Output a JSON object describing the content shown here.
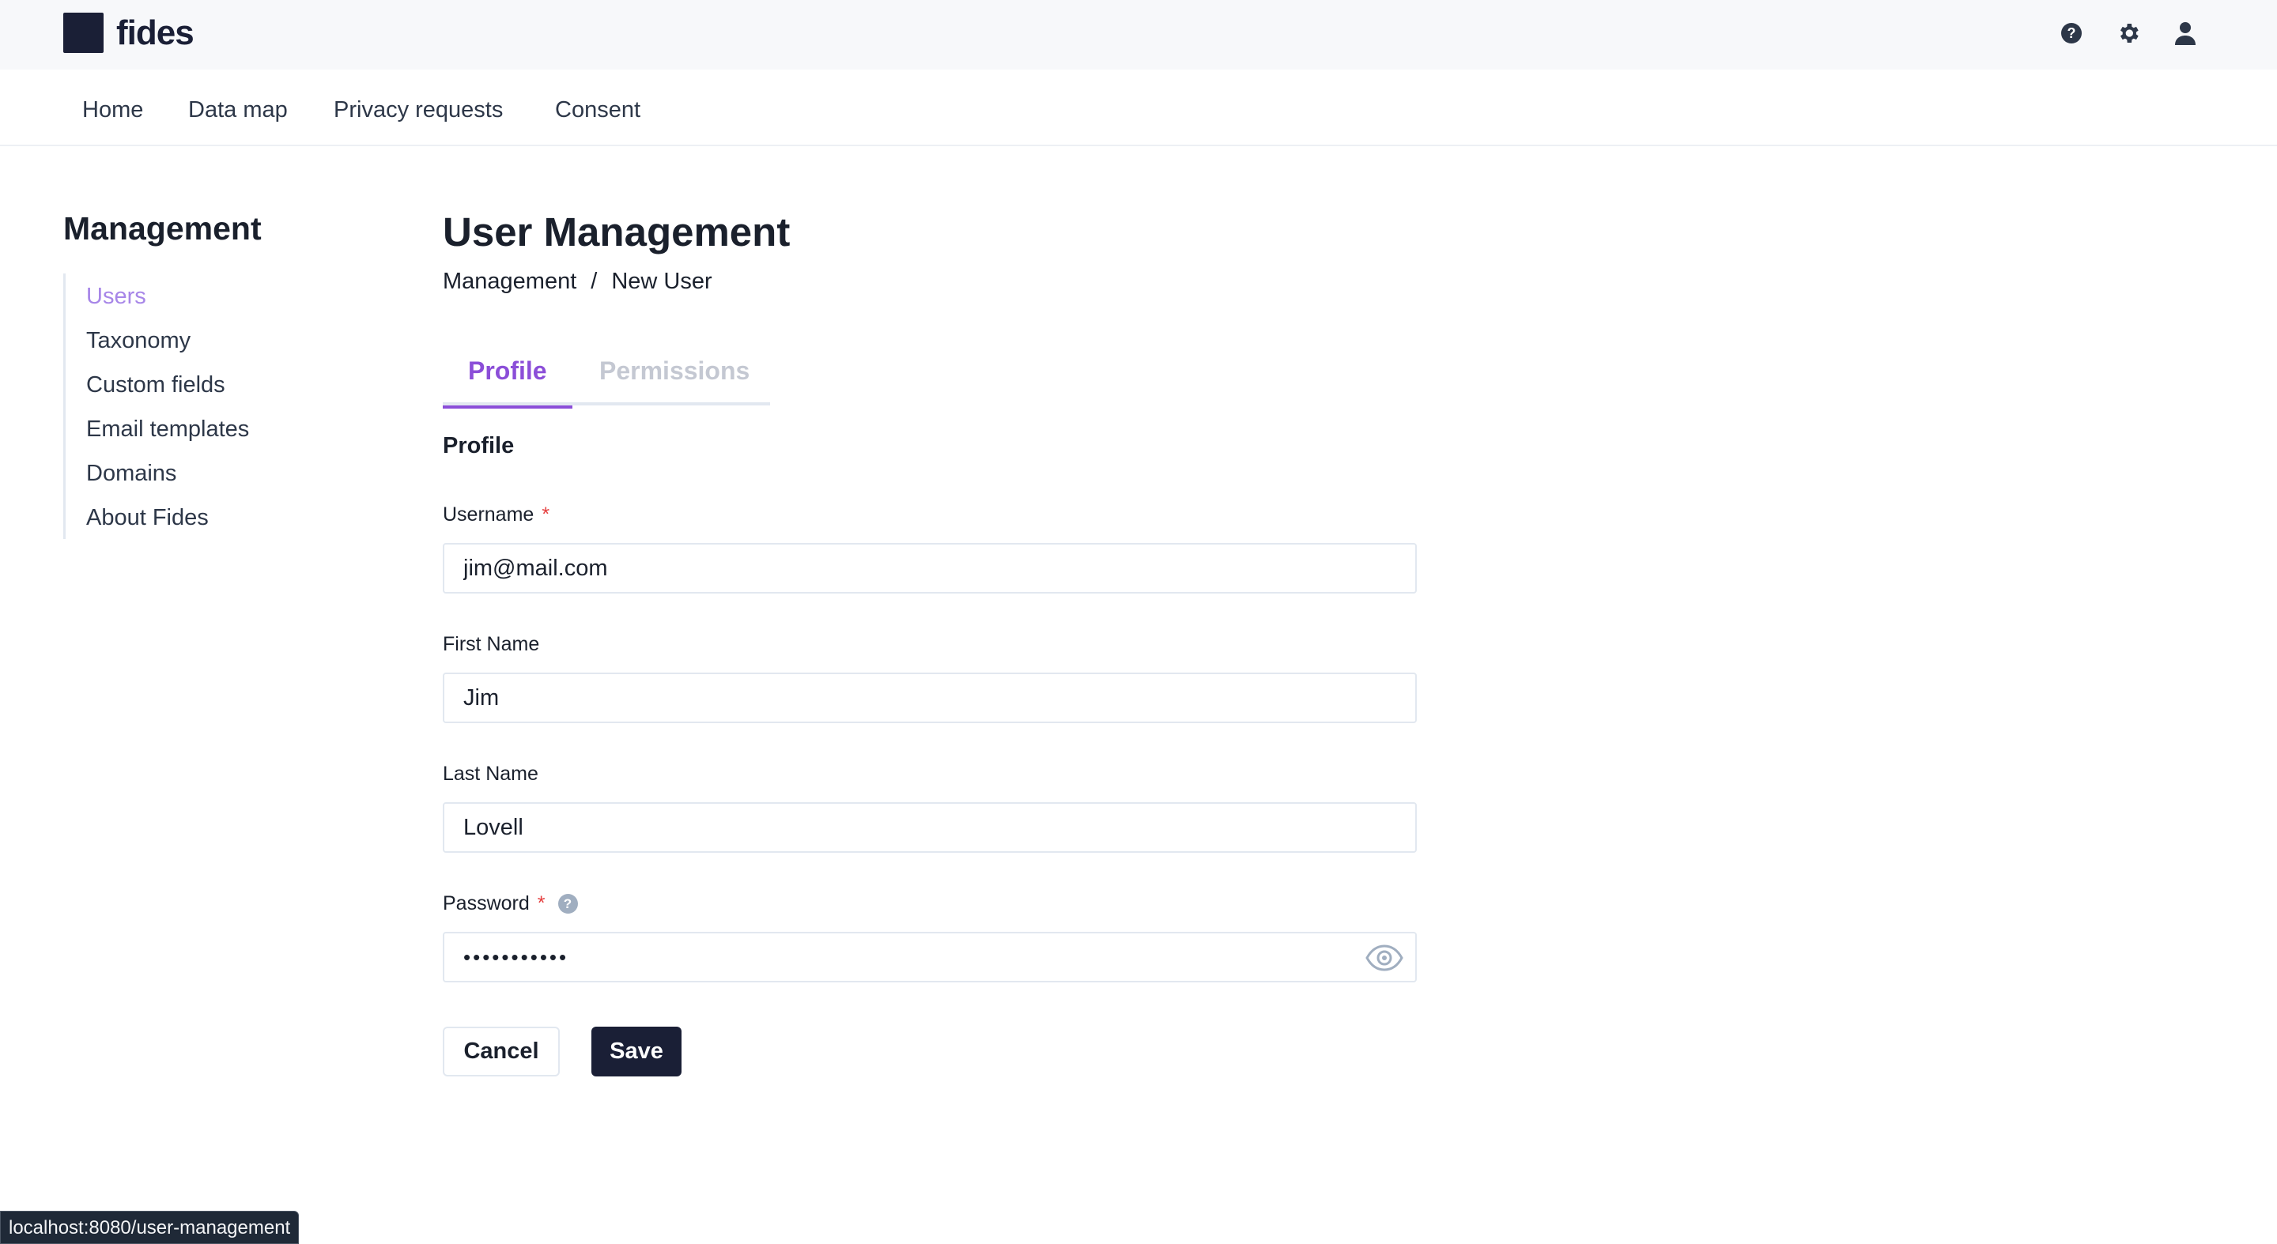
{
  "app": {
    "logo_text": "fides"
  },
  "topbar": {
    "icons": [
      "help-icon",
      "gear-icon",
      "user-icon"
    ]
  },
  "nav": {
    "items": [
      {
        "label": "Home"
      },
      {
        "label": "Data map"
      },
      {
        "label": "Privacy requests"
      },
      {
        "label": "Consent"
      }
    ]
  },
  "sidebar": {
    "title": "Management",
    "items": [
      {
        "label": "Users",
        "active": true
      },
      {
        "label": "Taxonomy"
      },
      {
        "label": "Custom fields"
      },
      {
        "label": "Email templates"
      },
      {
        "label": "Domains"
      },
      {
        "label": "About Fides"
      }
    ]
  },
  "main": {
    "title": "User Management",
    "breadcrumb": {
      "parent": "Management",
      "separator": "/",
      "current": "New User"
    },
    "tabs": [
      {
        "label": "Profile",
        "active": true
      },
      {
        "label": "Permissions"
      }
    ],
    "section_title": "Profile",
    "form": {
      "username": {
        "label": "Username",
        "required_mark": "*",
        "value": "jim@mail.com"
      },
      "first_name": {
        "label": "First Name",
        "value": "Jim"
      },
      "last_name": {
        "label": "Last Name",
        "value": "Lovell"
      },
      "password": {
        "label": "Password",
        "required_mark": "*",
        "help_glyph": "?",
        "value": "•••••••••••"
      }
    },
    "buttons": {
      "cancel": "Cancel",
      "save": "Save"
    }
  },
  "statusbar": {
    "url": "localhost:8080/user-management"
  },
  "colors": {
    "accent": "#8b4ed8",
    "active_sidebar": "#a786e8",
    "dark": "#1a1f36",
    "required": "#e53e3e"
  }
}
